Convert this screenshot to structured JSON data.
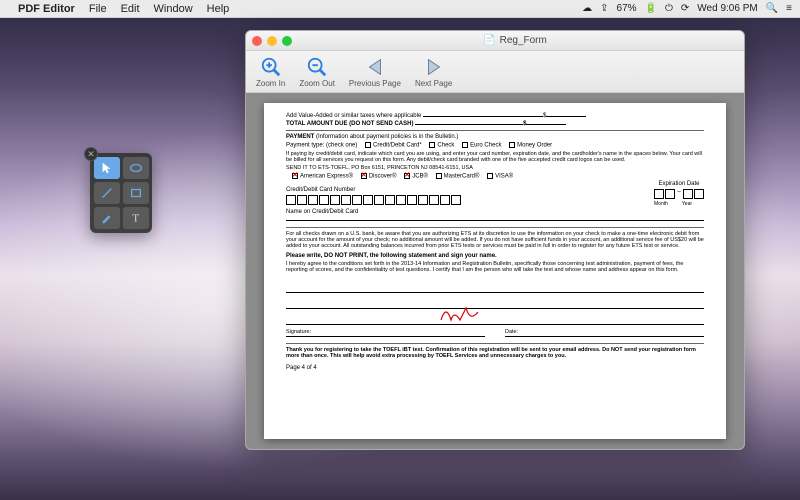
{
  "menubar": {
    "app": "PDF Editor",
    "items": [
      "File",
      "Edit",
      "Window",
      "Help"
    ],
    "battery": "67%",
    "clock": "Wed 9:06 PM"
  },
  "window": {
    "title": "Reg_Form",
    "toolbar": {
      "zoom_in": "Zoom In",
      "zoom_out": "Zoom Out",
      "prev": "Previous Page",
      "next": "Next Page"
    }
  },
  "doc": {
    "value_added": "Add Value-Added or similar taxes where applicable",
    "total_due": "TOTAL AMOUNT DUE (DO NOT SEND CASH)",
    "currency": "$",
    "payment_header": "PAYMENT",
    "payment_note": "(Information about payment policies is in the Bulletin.)",
    "payment_type_label": "Payment type: (check one)",
    "pt_credit": "Credit/Debit Card*",
    "pt_check": "Check",
    "pt_euro": "Euro Check",
    "pt_mo": "Money Order",
    "card_instr": "If paying by credit/debit card, indicate which card you are using, and enter your card number, expiration date, and the cardholder's name in the spaces below. Your card will be billed for all services you request on this form. Any debit/check card branded with one of the five accepted credit card logos can be used.",
    "send_to": "SEND IT TO ETS-TOEFL, PO Box 6151, PRINCETON NJ 08541-6151, USA",
    "amex": "American Express®",
    "discover": "Discover®",
    "jcb": "JCB®",
    "mastercard": "MasterCard®",
    "visa": "VISA®",
    "card_num_label": "Credit/Debit Card Number",
    "exp_label": "Expiration Date",
    "month": "Month",
    "year": "Year",
    "name_on_card": "Name on Credit/Debit Card",
    "us_bank_note": "For all checks drawn on a U.S. bank, be aware that you are authorizing ETS at its discretion to use the information on your check to make a one-time electronic debit from your account for the amount of your check; no additional amount will be added. If you do not have sufficient funds in your account, an additional service fee of US$20 will be added to your account. All outstanding balances incurred from prior ETS tests or services must be paid in full in order to register for any future ETS test or service.",
    "write_header": "Please write, DO NOT PRINT, the following statement and sign your name.",
    "agree_text": "I hereby agree to the conditions set forth in the 2013-14 Information and Registration Bulletin, specifically those concerning test administration, payment of fees, the reporting of scores, and the confidentiality of test questions. I certify that I am the person who will take the test and whose name and address appear on this form.",
    "signature_label": "Signature:",
    "date_label": "Date:",
    "thanks": "Thank you for registering to take the TOEFL iBT test. Confirmation of this registration will be sent to your email address. Do NOT send your registration form more than once. This will help avoid extra processing by TOEFL Services and unnecessary charges to you.",
    "page_num": "Page 4 of 4"
  },
  "palette": {
    "tools": [
      "pointer",
      "ellipse",
      "line",
      "rectangle",
      "highlighter",
      "text"
    ]
  }
}
